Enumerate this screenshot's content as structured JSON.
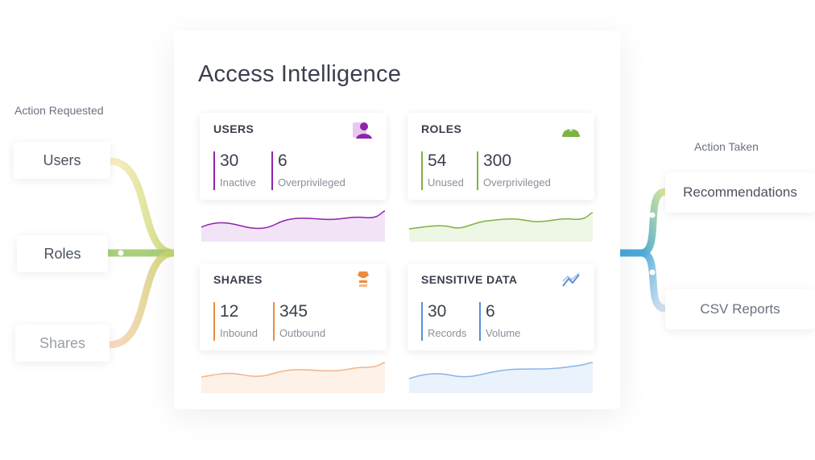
{
  "title": "Access Intelligence",
  "left": {
    "heading": "Action Requested",
    "items": [
      "Users",
      "Roles",
      "Shares"
    ]
  },
  "right": {
    "heading": "Action Taken",
    "items": [
      "Recommendations",
      "CSV Reports"
    ]
  },
  "cards": {
    "users": {
      "title": "USERS",
      "icon": "user-icon",
      "color": "#8e24aa",
      "metrics": [
        {
          "value": "30",
          "label": "Inactive"
        },
        {
          "value": "6",
          "label": "Overprivileged"
        }
      ]
    },
    "roles": {
      "title": "ROLES",
      "icon": "hard-hat-icon",
      "color": "#7cb342",
      "metrics": [
        {
          "value": "54",
          "label": "Unused"
        },
        {
          "value": "300",
          "label": "Overprivileged"
        }
      ]
    },
    "shares": {
      "title": "SHARES",
      "icon": "share-stack-icon",
      "color": "#ef8a3c",
      "metrics": [
        {
          "value": "12",
          "label": "Inbound"
        },
        {
          "value": "345",
          "label": "Outbound"
        }
      ]
    },
    "sensitive": {
      "title": "SENSITIVE DATA",
      "icon": "trend-icon",
      "color": "#5b8fd6",
      "metrics": [
        {
          "value": "30",
          "label": "Records"
        },
        {
          "value": "6",
          "label": "Volume"
        }
      ]
    }
  },
  "colors": {
    "users_flow": "#f3d98a",
    "roles_flow": "#8bc34a",
    "shares_flow": "#f4a774",
    "output_flow": "#4aa9d6"
  }
}
